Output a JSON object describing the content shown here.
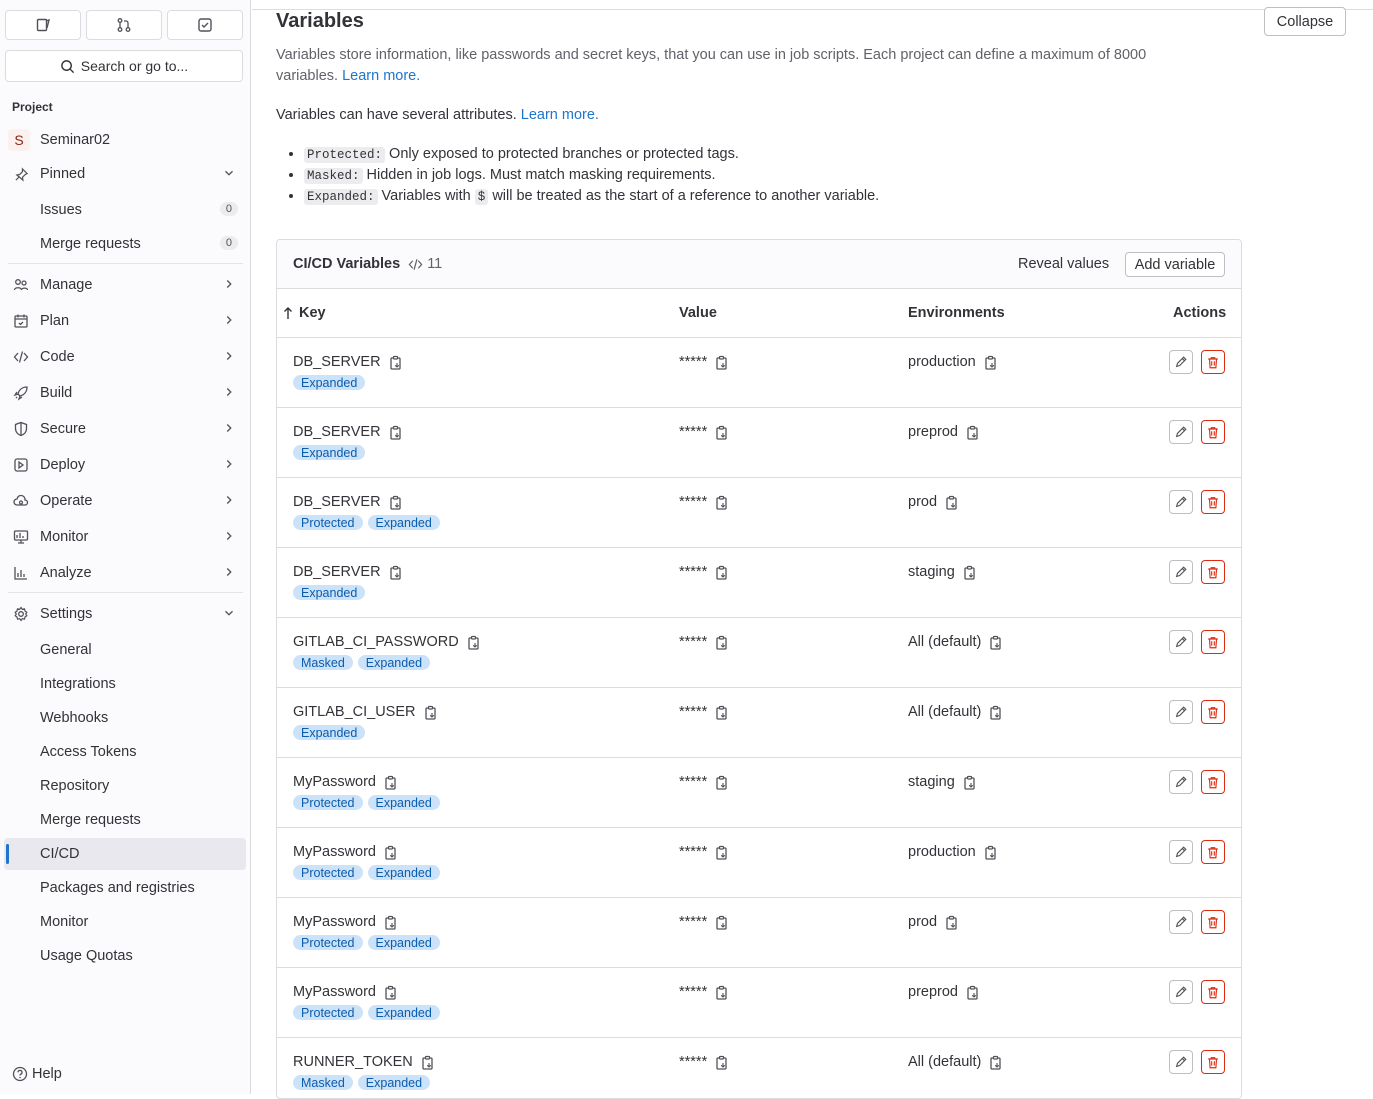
{
  "sidebar": {
    "search_label": "Search or go to...",
    "section_label": "Project",
    "project": {
      "initial": "S",
      "name": "Seminar02"
    },
    "pinned": {
      "label": "Pinned",
      "items": [
        {
          "label": "Issues",
          "count": "0"
        },
        {
          "label": "Merge requests",
          "count": "0"
        }
      ]
    },
    "groups": [
      {
        "label": "Manage",
        "icon": "users-icon"
      },
      {
        "label": "Plan",
        "icon": "calendar-icon"
      },
      {
        "label": "Code",
        "icon": "code-icon"
      },
      {
        "label": "Build",
        "icon": "rocket-icon"
      },
      {
        "label": "Secure",
        "icon": "shield-icon"
      },
      {
        "label": "Deploy",
        "icon": "deploy-icon"
      },
      {
        "label": "Operate",
        "icon": "cloud-gear-icon"
      },
      {
        "label": "Monitor",
        "icon": "monitor-icon"
      },
      {
        "label": "Analyze",
        "icon": "chart-icon"
      }
    ],
    "settings": {
      "label": "Settings",
      "items": [
        "General",
        "Integrations",
        "Webhooks",
        "Access Tokens",
        "Repository",
        "Merge requests",
        "CI/CD",
        "Packages and registries",
        "Monitor",
        "Usage Quotas"
      ],
      "active": "CI/CD"
    },
    "help_label": "Help"
  },
  "main": {
    "title": "Variables",
    "collapse_label": "Collapse",
    "desc_text": "Variables store information, like passwords and secret keys, that you can use in job scripts. Each project can define a maximum of 8000 variables.",
    "learn_more": "Learn more.",
    "attrs_intro": "Variables can have several attributes.",
    "attrs": [
      {
        "code": "Protected:",
        "text": "Only exposed to protected branches or protected tags."
      },
      {
        "code": "Masked:",
        "text": "Hidden in job logs. Must match masking requirements."
      },
      {
        "code": "Expanded:",
        "text_before": "Variables with",
        "inline_code": "$",
        "text_after": "will be treated as the start of a reference to another variable."
      }
    ]
  },
  "card": {
    "title": "CI/CD Variables",
    "count": "11",
    "reveal_label": "Reveal values",
    "add_label": "Add variable",
    "columns": {
      "key": "Key",
      "value": "Value",
      "env": "Environments",
      "actions": "Actions"
    },
    "rows": [
      {
        "key": "DB_SERVER",
        "badges": [
          "Expanded"
        ],
        "value": "*****",
        "env": "production"
      },
      {
        "key": "DB_SERVER",
        "badges": [
          "Expanded"
        ],
        "value": "*****",
        "env": "preprod"
      },
      {
        "key": "DB_SERVER",
        "badges": [
          "Protected",
          "Expanded"
        ],
        "value": "*****",
        "env": "prod"
      },
      {
        "key": "DB_SERVER",
        "badges": [
          "Expanded"
        ],
        "value": "*****",
        "env": "staging"
      },
      {
        "key": "GITLAB_CI_PASSWORD",
        "badges": [
          "Masked",
          "Expanded"
        ],
        "value": "*****",
        "env": "All (default)"
      },
      {
        "key": "GITLAB_CI_USER",
        "badges": [
          "Expanded"
        ],
        "value": "*****",
        "env": "All (default)"
      },
      {
        "key": "MyPassword",
        "badges": [
          "Protected",
          "Expanded"
        ],
        "value": "*****",
        "env": "staging"
      },
      {
        "key": "MyPassword",
        "badges": [
          "Protected",
          "Expanded"
        ],
        "value": "*****",
        "env": "production"
      },
      {
        "key": "MyPassword",
        "badges": [
          "Protected",
          "Expanded"
        ],
        "value": "*****",
        "env": "prod"
      },
      {
        "key": "MyPassword",
        "badges": [
          "Protected",
          "Expanded"
        ],
        "value": "*****",
        "env": "preprod"
      },
      {
        "key": "RUNNER_TOKEN",
        "badges": [
          "Masked",
          "Expanded"
        ],
        "value": "*****",
        "env": "All (default)"
      }
    ]
  }
}
